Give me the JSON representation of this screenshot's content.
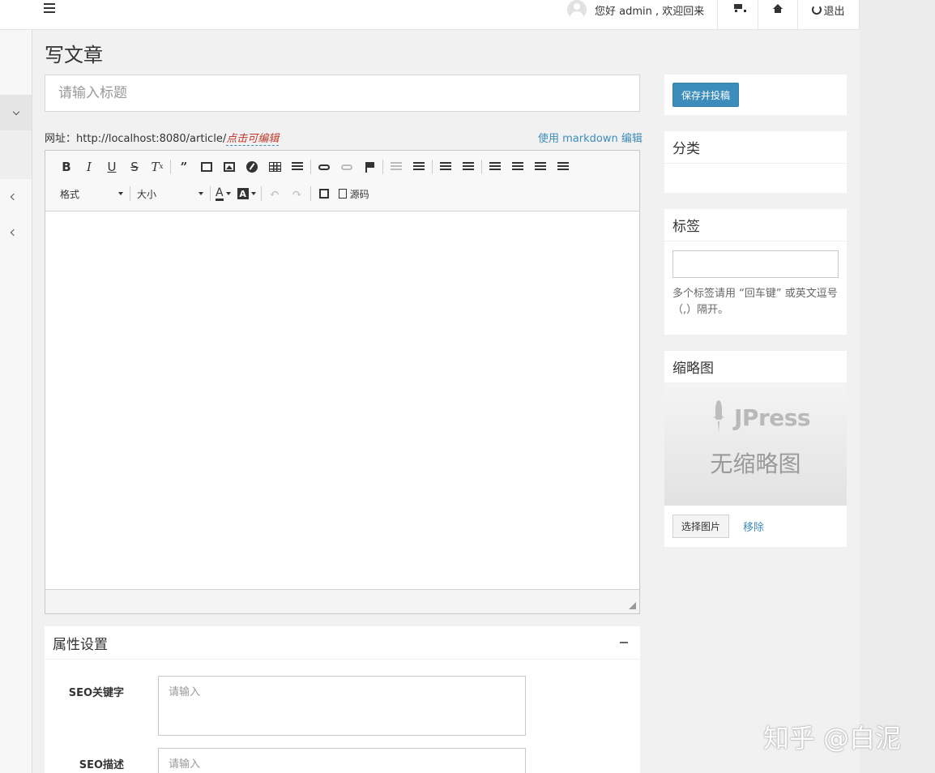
{
  "header": {
    "greeting": "您好 admin , 欢迎回来",
    "logout_label": "退出",
    "cart_icon": "shopping-cart-icon",
    "home_icon": "home-icon",
    "logout_icon": "power-icon"
  },
  "page": {
    "title": "写文章",
    "title_placeholder": "请输入标题",
    "url_label": "网址：",
    "url_value": "http://localhost:8080/article/",
    "url_edit_label": "点击可编辑",
    "markdown_link": "使用 markdown 编辑"
  },
  "editor": {
    "format_label": "格式",
    "size_label": "大小",
    "source_label": "源码"
  },
  "attributes": {
    "title": "属性设置",
    "seo_keywords_label": "SEO关键字",
    "seo_keywords_placeholder": "请输入",
    "seo_description_label": "SEO描述",
    "seo_description_placeholder": "请输入"
  },
  "side": {
    "save_button": "保存并投稿",
    "category_title": "分类",
    "tags_title": "标签",
    "tags_help": "多个标签请用 “回车键” 或英文逗号（,）隔开。",
    "thumb_title": "缩略图",
    "thumb_brand": "JPress",
    "thumb_placeholder": "无缩略图",
    "pick_image": "选择图片",
    "remove": "移除"
  },
  "watermark": "知乎 @白泥",
  "colors": {
    "primary": "#3c8dbc",
    "url_edit": "#c0392b"
  }
}
